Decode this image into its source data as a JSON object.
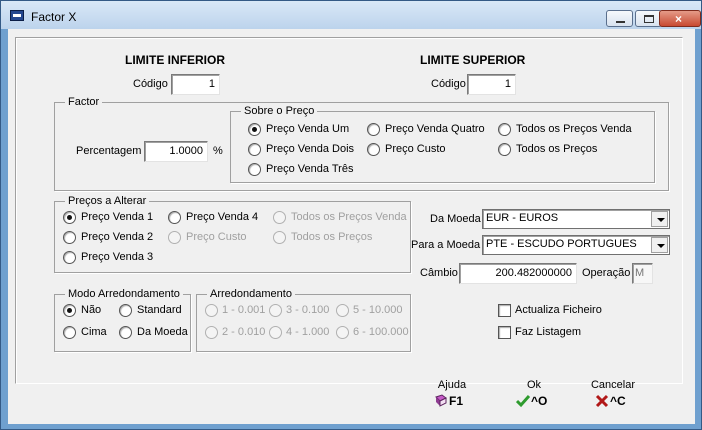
{
  "window": {
    "title": "Factor X"
  },
  "limits": {
    "inferior": {
      "heading": "LIMITE INFERIOR",
      "code_label": "Código",
      "code_value": "1"
    },
    "superior": {
      "heading": "LIMITE SUPERIOR",
      "code_label": "Código",
      "code_value": "1"
    }
  },
  "factor": {
    "legend": "Factor",
    "percent_label": "Percentagem",
    "percent_value": "1.0000",
    "percent_symbol": "%",
    "sobre": {
      "legend": "Sobre o Preço",
      "options": [
        "Preço Venda Um",
        "Preço Venda Quatro",
        "Todos os Preços Venda",
        "Preço Venda Dois",
        "Preço Custo",
        "Todos os Preços",
        "Preço Venda Três"
      ]
    }
  },
  "precos": {
    "legend": "Preços a Alterar",
    "options": [
      "Preço Venda 1",
      "Preço Venda 4",
      "Todos os Preços Venda",
      "Preço Venda 2",
      "Preço Custo",
      "Todos os Preços",
      "Preço Venda 3"
    ]
  },
  "currency": {
    "from_label": "Da Moeda",
    "from_value": "EUR - EUROS",
    "to_label": "Para a Moeda",
    "to_value": "PTE - ESCUDO PORTUGUES",
    "rate_label": "Câmbio",
    "rate_value": "200.482000000",
    "operation_label": "Operação",
    "operation_value": "M"
  },
  "modo": {
    "legend": "Modo Arredondamento",
    "options": [
      "Não",
      "Standard",
      "Cima",
      "Da Moeda"
    ]
  },
  "arred": {
    "legend": "Arredondamento",
    "options": [
      "1 - 0.001",
      "3 - 0.100",
      "5 - 10.000",
      "2 - 0.010",
      "4 - 1.000",
      "6 - 100.000"
    ]
  },
  "checks": {
    "actualiza": "Actualiza Ficheiro",
    "listagem": "Faz Listagem"
  },
  "commands": {
    "help": {
      "label": "Ajuda",
      "key": "F1"
    },
    "ok": {
      "label": "Ok",
      "key": "^O"
    },
    "cancel": {
      "label": "Cancelar",
      "key": "^C"
    }
  }
}
